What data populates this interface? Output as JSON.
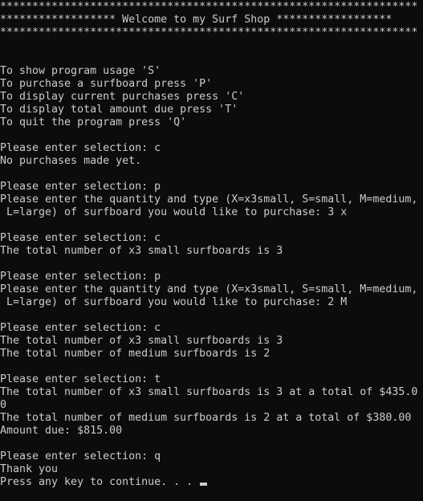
{
  "terminal": {
    "colors": {
      "background": "#0c0c0c",
      "text": "#cccccc"
    },
    "lines": [
      "*****************************************************************",
      "****************** Welcome to my Surf Shop ******************",
      "*****************************************************************",
      "",
      "",
      "To show program usage 'S'",
      "To purchase a surfboard press 'P'",
      "To display current purchases press 'C'",
      "To display total amount due press 'T'",
      "To quit the program press 'Q'",
      "",
      "Please enter selection: c",
      "No purchases made yet.",
      "",
      "Please enter selection: p",
      "Please enter the quantity and type (X=x3small, S=small, M=medium,",
      " L=large) of surfboard you would like to purchase: 3 x",
      "",
      "Please enter selection: c",
      "The total number of x3 small surfboards is 3",
      "",
      "Please enter selection: p",
      "Please enter the quantity and type (X=x3small, S=small, M=medium,",
      " L=large) of surfboard you would like to purchase: 2 M",
      "",
      "Please enter selection: c",
      "The total number of x3 small surfboards is 3",
      "The total number of medium surfboards is 2",
      "",
      "Please enter selection: t",
      "The total number of x3 small surfboards is 3 at a total of $435.0",
      "0",
      "The total number of medium surfboards is 2 at a total of $380.00",
      "Amount due: $815.00",
      "",
      "Please enter selection: q",
      "Thank you",
      "Press any key to continue. . . "
    ]
  }
}
